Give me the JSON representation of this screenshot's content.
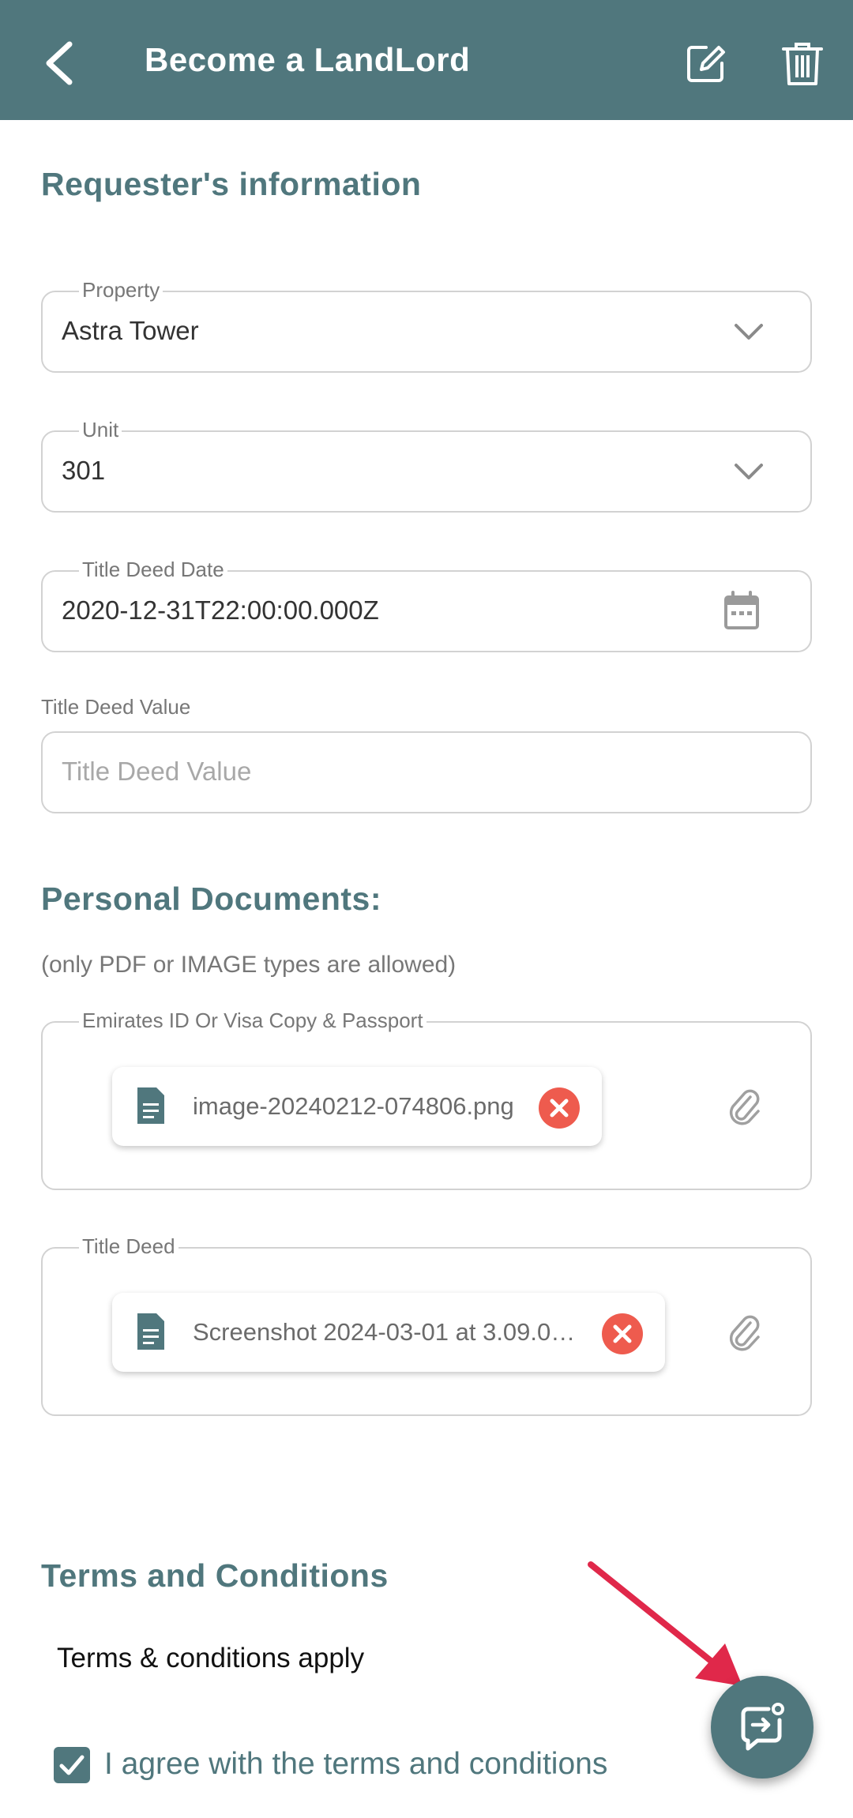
{
  "header": {
    "title": "Become a LandLord",
    "back_icon": "chevron-left-icon",
    "edit_icon": "edit-icon",
    "delete_icon": "trash-icon",
    "bg_color": "#50777d"
  },
  "requester": {
    "section_title": "Requester's information",
    "property": {
      "label": "Property",
      "value": "Astra Tower"
    },
    "unit": {
      "label": "Unit",
      "value": "301"
    },
    "title_deed_date": {
      "label": "Title Deed Date",
      "value": "2020-12-31T22:00:00.000Z"
    },
    "title_deed_value": {
      "label": "Title Deed Value",
      "placeholder": "Title Deed Value",
      "value": ""
    }
  },
  "documents": {
    "section_title": "Personal Documents:",
    "hint": "(only PDF or IMAGE types are allowed)",
    "emirates_id": {
      "label": "Emirates ID Or Visa Copy & Passport",
      "file": "image-20240212-074806.png"
    },
    "title_deed": {
      "label": "Title Deed",
      "file": "Screenshot 2024-03-01 at 3.09.0…"
    }
  },
  "terms": {
    "section_title": "Terms and Conditions",
    "text": "Terms & conditions apply",
    "agree_label": "I agree with the terms and conditions",
    "agree_checked": true
  },
  "fab": {
    "icon": "submit-arrow-icon"
  },
  "colors": {
    "accent": "#50777d",
    "remove": "#ee5b4e",
    "annotation": "#e0284a"
  }
}
